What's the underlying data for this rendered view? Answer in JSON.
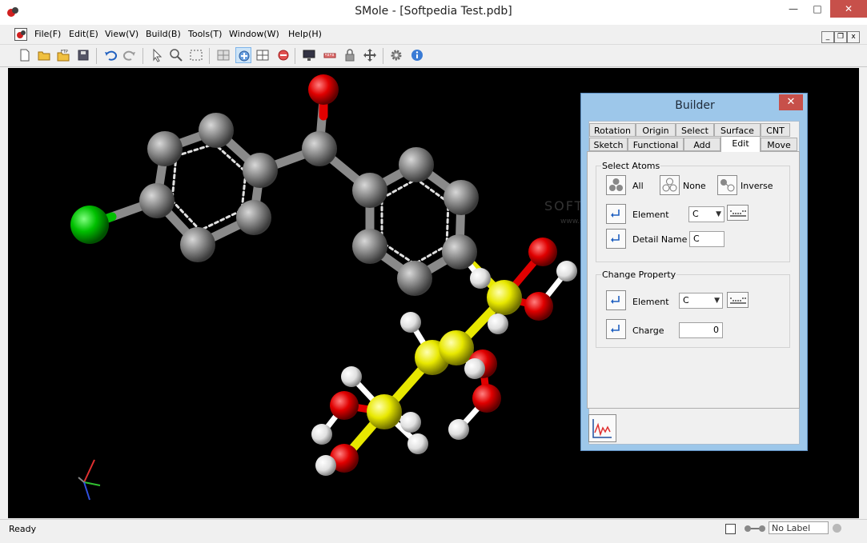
{
  "window": {
    "title": "SMole - [Softpedia Test.pdb]"
  },
  "menu": [
    "File(F)",
    "Edit(E)",
    "View(V)",
    "Build(B)",
    "Tools(T)",
    "Window(W)",
    "Help(H)"
  ],
  "statusbar": {
    "status": "Ready",
    "label_field": "No Label"
  },
  "viewport": {
    "watermark": "SOFTPEDIA",
    "watermark_url": "www.softpedia.com",
    "background": "#000000"
  },
  "builder": {
    "title": "Builder",
    "tabs_row1": [
      "Rotation",
      "Origin",
      "Select",
      "Surface",
      "CNT"
    ],
    "tabs_row2": [
      "Sketch",
      "Functional",
      "Add",
      "Edit",
      "Move"
    ],
    "selected_tab": "Edit",
    "select_atoms": {
      "title": "Select Atoms",
      "all_label": "All",
      "none_label": "None",
      "inverse_label": "Inverse",
      "element_label": "Element",
      "element_value": "C",
      "detail_name_label": "Detail Name",
      "detail_name_value": "C"
    },
    "change_property": {
      "title": "Change Property",
      "element_label": "Element",
      "element_value": "C",
      "charge_label": "Charge",
      "charge_value": "0"
    }
  },
  "colors": {
    "carbon": "#8a8a8a",
    "oxygen": "#e00000",
    "chlorine": "#00c000",
    "sulfur": "#e8e800",
    "hydrogen": "#ffffff",
    "accent": "#9dc7ea"
  }
}
